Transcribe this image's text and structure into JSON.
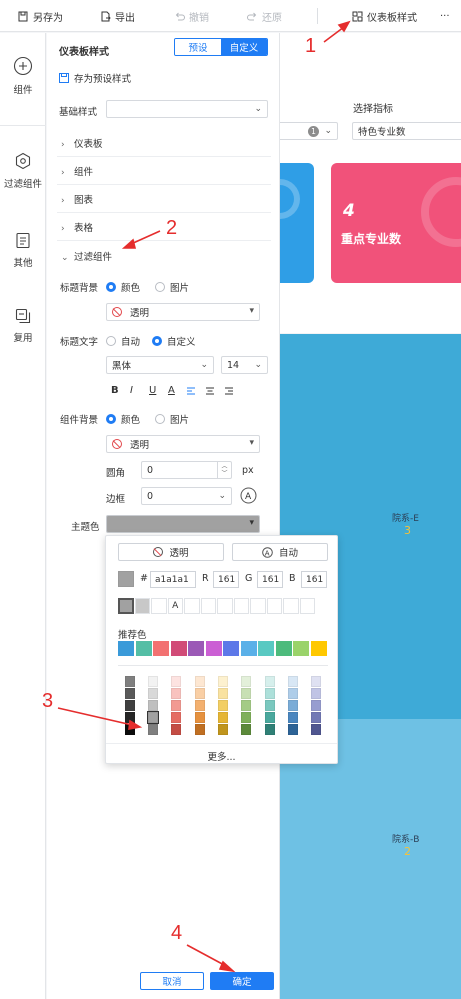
{
  "toolbar": {
    "save_as": "另存为",
    "export": "导出",
    "undo": "撤销",
    "redo": "还原",
    "dashboard_style": "仪表板样式",
    "more": "···"
  },
  "rail": {
    "items": [
      {
        "label": "组件",
        "icon": "plus-circle-icon"
      },
      {
        "label": "过滤组件",
        "icon": "hexagon-icon"
      },
      {
        "label": "其他",
        "icon": "document-icon"
      },
      {
        "label": "复用",
        "icon": "copy-icon"
      }
    ]
  },
  "panel": {
    "title": "仪表板样式",
    "tab_preset": "预设",
    "tab_custom": "自定义",
    "save_preset": "存为预设样式",
    "base_style_label": "基础样式",
    "base_style_value": "",
    "sections": [
      "仪表板",
      "组件",
      "图表",
      "表格"
    ],
    "filter_section": "过滤组件",
    "title_bg_label": "标题背景",
    "opt_color": "颜色",
    "opt_image": "图片",
    "transparent": "透明",
    "title_text_label": "标题文字",
    "opt_auto": "自动",
    "opt_custom": "自定义",
    "font_family": "黑体",
    "font_size": "14",
    "format_buttons": [
      "B",
      "I",
      "U",
      "A"
    ],
    "comp_bg_label": "组件背景",
    "corner_label": "圆角",
    "corner_value": "0",
    "corner_unit": "px",
    "border_label": "边框",
    "border_value": "0",
    "theme_label": "主题色",
    "cancel": "取消",
    "confirm": "确定"
  },
  "popup": {
    "transparent": "透明",
    "auto": "自动",
    "hash": "#",
    "hex": "a1a1a1",
    "r_label": "R",
    "r": "161",
    "g_label": "G",
    "g": "161",
    "b_label": "B",
    "b": "161",
    "recommended": "推荐色",
    "more": "更多...",
    "selected_color": "#a1a1a1",
    "recent_colors": [
      "#a1a1a1",
      "#c8c8c8",
      "#ffffff"
    ],
    "recommended_colors": [
      "#3a9ad9",
      "#54bea5",
      "#f27171",
      "#d14b77",
      "#9b59b6",
      "#cb5fd4",
      "#5d78e8",
      "#5ab0e8",
      "#59c9c2",
      "#4dbb7c",
      "#9ad36a",
      "#ffc800"
    ],
    "palette_columns": [
      [
        "#7f7f7f",
        "#595959",
        "#3f3f3f",
        "#262626",
        "#0c0c0c"
      ],
      [
        "#f2f2f2",
        "#d9d9d9",
        "#bfbfbf",
        "#a1a1a1",
        "#7f7f7f"
      ],
      [
        "#fde3e1",
        "#f9c3bf",
        "#f29a92",
        "#e56c62",
        "#c44d44"
      ],
      [
        "#fde7d2",
        "#f9cfa5",
        "#f3b06f",
        "#e6913e",
        "#c06f22"
      ],
      [
        "#fdf1cf",
        "#f9e2a0",
        "#f2ce63",
        "#e5b534",
        "#c0951d"
      ],
      [
        "#e3f0da",
        "#c8e0b4",
        "#a4cb86",
        "#7fb05a",
        "#5c8a3b"
      ],
      [
        "#d6efec",
        "#ade0da",
        "#7ac8bf",
        "#4aa89d",
        "#2f8076"
      ],
      [
        "#d8e7f5",
        "#aecde9",
        "#7aacd7",
        "#4a86bf",
        "#2d6396"
      ],
      [
        "#dfe1f2",
        "#c0c4e5",
        "#979dd0",
        "#7279b5",
        "#4f5690"
      ]
    ]
  },
  "dashboard": {
    "select_metric": "选择指标",
    "metric_value": "特色专业数",
    "dropdown_badge": "1",
    "card_number": "4",
    "card_label": "重点专业数",
    "block1_label": "院系-E",
    "block1_value": "3",
    "block2_label": "院系-B",
    "block2_value": "2"
  },
  "annotations": [
    "1",
    "2",
    "3",
    "4"
  ],
  "colors": {
    "accent": "#1f7cf4",
    "pink_card": "#f1527a",
    "blue_card": "#2f9ee6",
    "block_dark": "#3eaad7",
    "block_light": "#6ec1e4",
    "annotation": "#e52d2d"
  }
}
